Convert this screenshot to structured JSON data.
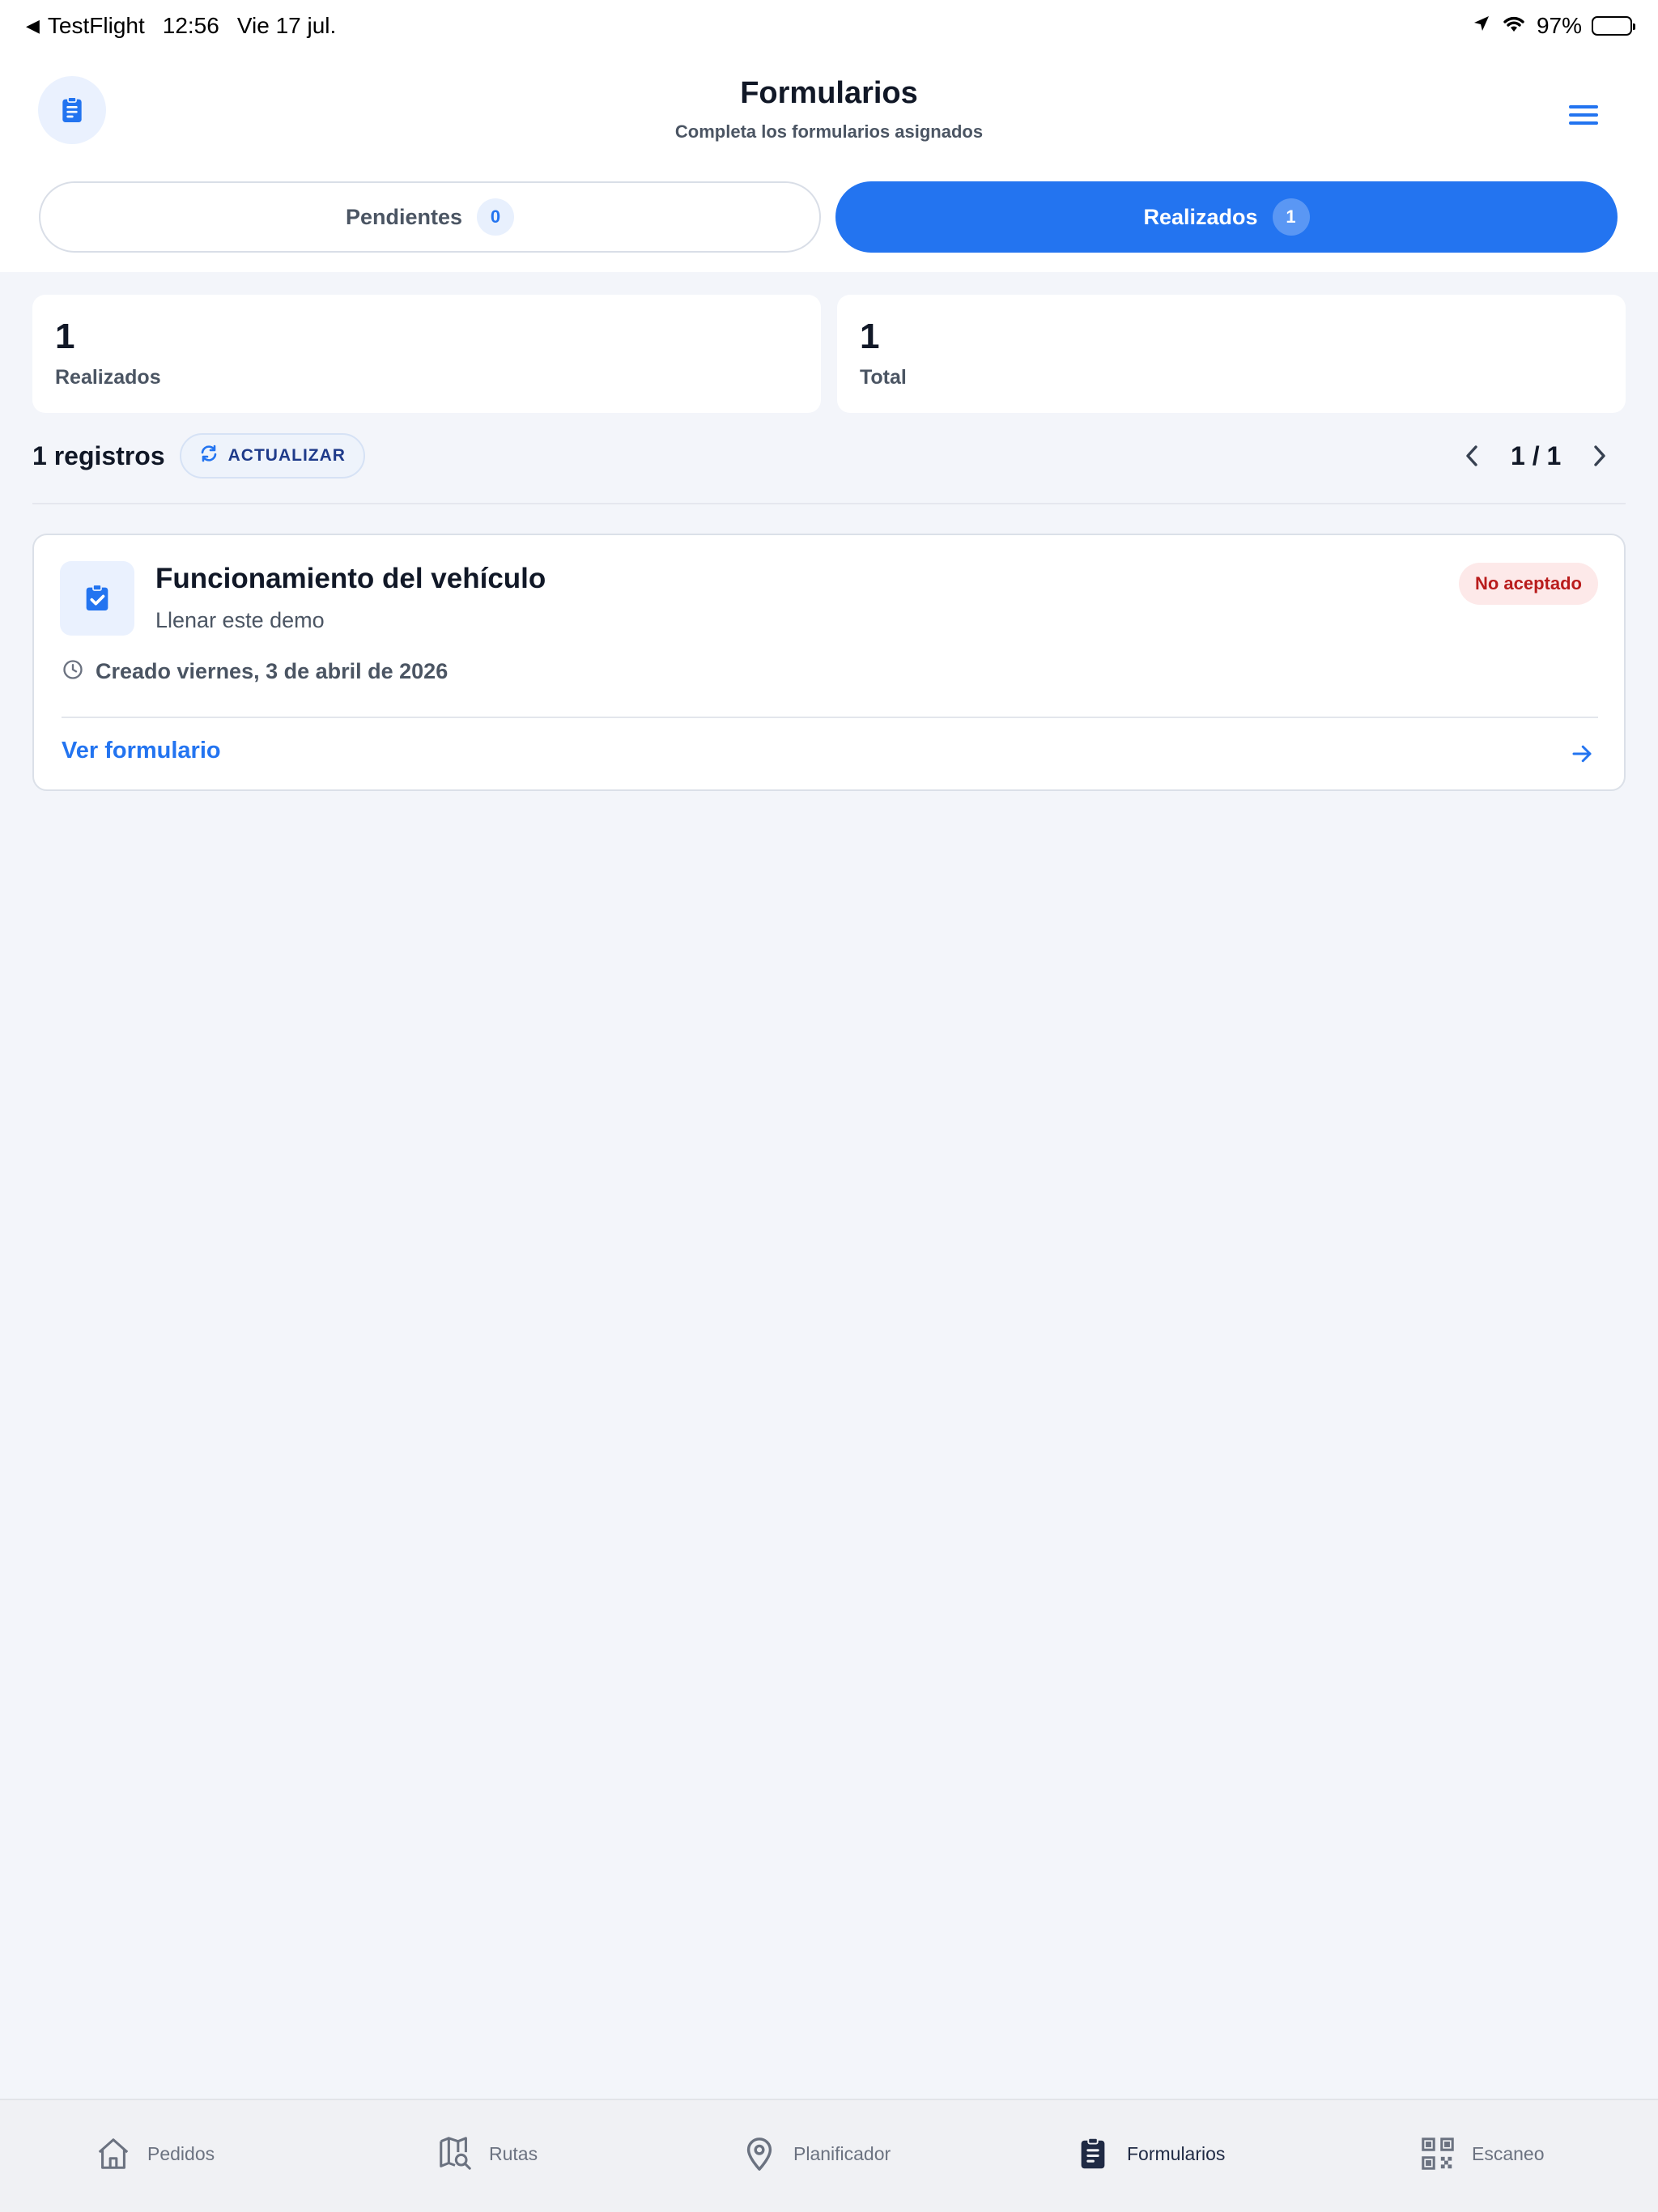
{
  "status_bar": {
    "back_app": "TestFlight",
    "time": "12:56",
    "date": "Vie 17 jul.",
    "battery": "97%"
  },
  "header": {
    "title": "Formularios",
    "subtitle": "Completa los formularios asignados",
    "left_icon": "clipboard-icon",
    "right_icon": "hamburger-menu-icon"
  },
  "tabs": [
    {
      "label": "Pendientes",
      "count": "0",
      "active": false
    },
    {
      "label": "Realizados",
      "count": "1",
      "active": true
    }
  ],
  "stats": [
    {
      "value": "1",
      "label": "Realizados"
    },
    {
      "value": "1",
      "label": "Total"
    }
  ],
  "records": {
    "count_text": "1 registros",
    "refresh_label": "ACTUALIZAR",
    "page": "1 / 1"
  },
  "card": {
    "title": "Funcionamiento del vehículo",
    "subtitle": "Llenar este demo",
    "status": "No aceptado",
    "created": "Creado viernes, 3 de abril de 2026",
    "link": "Ver formulario"
  },
  "bottom_nav": [
    {
      "label": "Pedidos",
      "icon": "home-icon",
      "active": false
    },
    {
      "label": "Rutas",
      "icon": "map-search-icon",
      "active": false
    },
    {
      "label": "Planificador",
      "icon": "map-pin-icon",
      "active": false
    },
    {
      "label": "Formularios",
      "icon": "clipboard-list-icon",
      "active": true
    },
    {
      "label": "Escaneo",
      "icon": "qr-code-icon",
      "active": false
    }
  ],
  "colors": {
    "accent": "#2374f0",
    "background": "#f3f5fa",
    "badge_bg": "#fde9e9",
    "badge_text": "#b91c1c"
  }
}
